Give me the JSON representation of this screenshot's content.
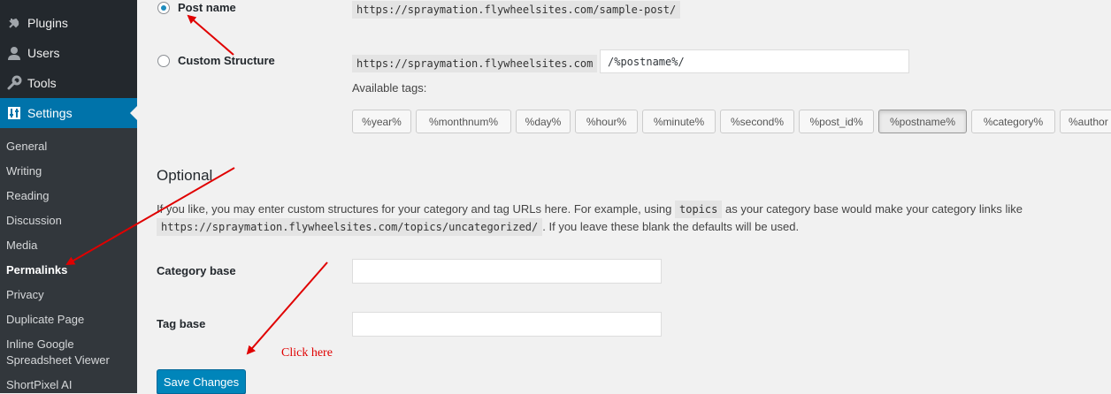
{
  "sidebar": {
    "menu": [
      {
        "label": "Plugins",
        "icon": "plug-icon"
      },
      {
        "label": "Users",
        "icon": "user-icon"
      },
      {
        "label": "Tools",
        "icon": "wrench-icon"
      },
      {
        "label": "Settings",
        "icon": "settings-icon",
        "current": true
      }
    ],
    "submenu": [
      "General",
      "Writing",
      "Reading",
      "Discussion",
      "Media",
      "Permalinks",
      "Privacy",
      "Duplicate Page",
      "Inline Google Spreadsheet Viewer",
      "ShortPixel AI"
    ],
    "current_submenu": "Permalinks"
  },
  "permalinks": {
    "post_name": {
      "label": "Post name",
      "example": "https://spraymation.flywheelsites.com/sample-post/",
      "checked": true
    },
    "custom": {
      "label": "Custom Structure",
      "base": "https://spraymation.flywheelsites.com",
      "value": "/%postname%/"
    },
    "available_tags_label": "Available tags:",
    "tags": [
      "%year%",
      "%monthnum%",
      "%day%",
      "%hour%",
      "%minute%",
      "%second%",
      "%post_id%",
      "%postname%",
      "%category%",
      "%author"
    ],
    "active_tag": "%postname%"
  },
  "optional": {
    "heading": "Optional",
    "desc_part1": "If you like, you may enter custom structures for your category and tag URLs here. For example, using",
    "desc_code1": "topics",
    "desc_part2": "as your category base would make your category links like",
    "desc_code2": "https://spraymation.flywheelsites.com/topics/uncategorized/",
    "desc_part3": ". If you leave these blank the defaults will be used.",
    "category_base_label": "Category base",
    "category_base_value": "",
    "tag_base_label": "Tag base",
    "tag_base_value": ""
  },
  "save_label": "Save Changes",
  "annotation": "Click here",
  "colors": {
    "accent": "#0073aa",
    "button": "#0085ba",
    "annotation": "#e00000"
  }
}
